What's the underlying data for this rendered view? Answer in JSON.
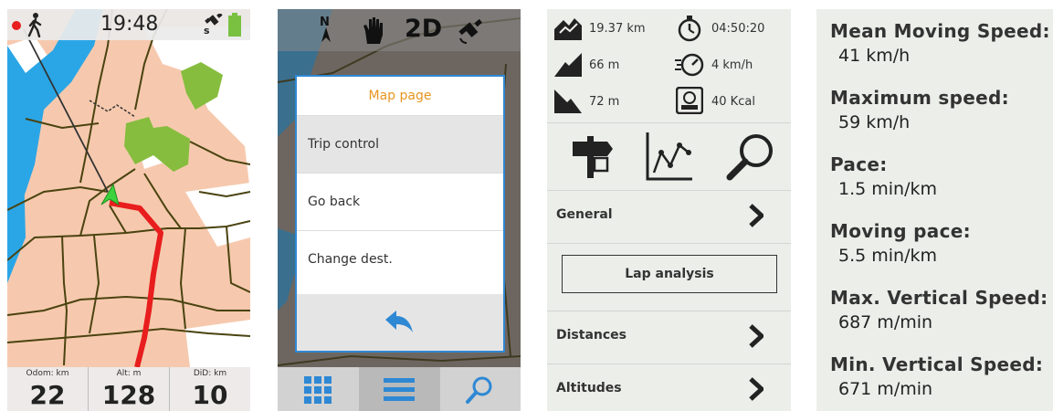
{
  "screen1": {
    "status": {
      "time": "19:48",
      "satellite_label": "s"
    },
    "counters": [
      {
        "label": "Odom: km",
        "value": "22"
      },
      {
        "label": "Alt: m",
        "value": "128"
      },
      {
        "label": "DiD: km",
        "value": "10"
      }
    ],
    "colors": {
      "water": "#2aa6e6",
      "land": "#f6c9ae",
      "park": "#86bd3e",
      "route": "#e81d1d",
      "road": "#4a4310"
    }
  },
  "screen2": {
    "toolbar": {
      "north_label": "N",
      "mode_label": "2D"
    },
    "menu": {
      "title": "Map page",
      "items": [
        "Trip control",
        "Go back",
        "Change dest."
      ]
    },
    "colors": {
      "menu_title": "#e6951f",
      "menu_border": "#2e88d4",
      "back_arrow": "#2e88d4"
    }
  },
  "screen3": {
    "stats": {
      "distance": "19.37 km",
      "time": "04:50:20",
      "ascent": "66 m",
      "speed": "4 km/h",
      "descent": "72 m",
      "calories": "40 Kcal"
    },
    "rows": {
      "general": "General",
      "lap_analysis": "Lap analysis",
      "distances": "Distances",
      "altitudes": "Altitudes"
    }
  },
  "screen4": {
    "metrics": [
      {
        "label": "Mean Moving Speed:",
        "value": "41 km/h"
      },
      {
        "label": "Maximum speed:",
        "value": "59 km/h"
      },
      {
        "label": "Pace:",
        "value": "1.5 min/km"
      },
      {
        "label": "Moving pace:",
        "value": "5.5 min/km"
      },
      {
        "label": "Max. Vertical Speed:",
        "value": "687 m/min"
      },
      {
        "label": "Min. Vertical Speed:",
        "value": "671 m/min"
      }
    ]
  }
}
